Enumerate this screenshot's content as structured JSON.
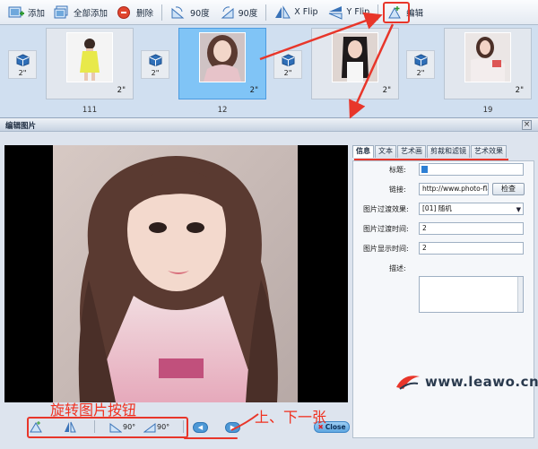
{
  "toolbar": {
    "add": "添加",
    "add_all": "全部添加",
    "delete": "删除",
    "rotate_ccw": "90度",
    "rotate_cw": "90度",
    "x_flip": "X Flip",
    "y_flip": "Y Flip",
    "edit": "编辑"
  },
  "filmstrip": {
    "frames": [
      {
        "duration": "2\"",
        "index": "111",
        "selected": false
      },
      {
        "duration": "2\"",
        "index": "12",
        "selected": true
      },
      {
        "duration": "2\"",
        "index": "",
        "selected": false
      },
      {
        "duration": "2\"",
        "index": "19",
        "selected": false
      }
    ],
    "transitions": [
      {
        "duration": "2\""
      },
      {
        "duration": "2\""
      },
      {
        "duration": "2\""
      },
      {
        "duration": "2\""
      }
    ]
  },
  "dialog": {
    "title": "编辑图片",
    "close_glyph": "×",
    "tabs": [
      "信息",
      "文本",
      "艺术画",
      "剪裁和滤镜",
      "艺术效果"
    ],
    "active_tab": "信息",
    "form": {
      "title_label": "标题:",
      "title_value": "",
      "link_label": "链接:",
      "link_value": "http://www.photo-flash-",
      "check_button": "检查",
      "transition_effect_label": "图片过渡效果:",
      "transition_effect_value": "[01] 随机",
      "transition_time_label": "图片过渡时间:",
      "transition_time_value": "2",
      "display_time_label": "图片显示时间:",
      "display_time_value": "2",
      "desc_label": "描述:"
    },
    "bottom": {
      "rotate_ccw": "90°",
      "rotate_cw": "90°",
      "close_button": "Close"
    }
  },
  "annotations": {
    "rotate_buttons": "旋转图片按钮",
    "prev_next": "上、下一张"
  },
  "watermark": {
    "text": "www.leawo.cn"
  },
  "colors": {
    "accent": "#4d9be0",
    "annotation": "#e8362a",
    "selected_frame": "#80c4f6"
  }
}
